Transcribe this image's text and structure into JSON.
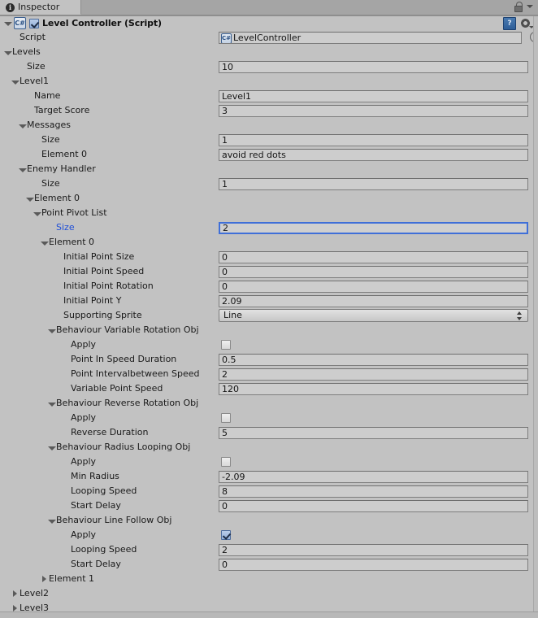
{
  "window": {
    "tab_label": "Inspector",
    "tab_icon": "info-circle-icon",
    "lock_icon": "padlock-open-icon",
    "menu_icon": "chevron-down-icon"
  },
  "component": {
    "title": "Level Controller (Script)",
    "script_icon": "csharp-script-icon",
    "enabled": true,
    "help_icon": "help-book-icon",
    "gear_icon": "gear-icon"
  },
  "colors": {
    "background": "#c2c2c2",
    "field_background": "#cdcdcd",
    "focus_border": "#3f6fd8",
    "selected_label": "#1f4fd8",
    "checkbox_checked": "#93b0da"
  },
  "rows": [
    {
      "label": "Script",
      "indent": 1,
      "fold": "none",
      "type": "object",
      "value": "LevelController",
      "picker": true
    },
    {
      "label": "Levels",
      "indent": 0,
      "fold": "open",
      "type": "none"
    },
    {
      "label": "Size",
      "indent": 2,
      "fold": "none",
      "type": "text",
      "value": "10"
    },
    {
      "label": "Level1",
      "indent": 1,
      "fold": "open",
      "type": "none"
    },
    {
      "label": "Name",
      "indent": 3,
      "fold": "none",
      "type": "text",
      "value": "Level1"
    },
    {
      "label": "Target Score",
      "indent": 3,
      "fold": "none",
      "type": "text",
      "value": "3"
    },
    {
      "label": "Messages",
      "indent": 2,
      "fold": "open",
      "type": "none"
    },
    {
      "label": "Size",
      "indent": 4,
      "fold": "none",
      "type": "text",
      "value": "1"
    },
    {
      "label": "Element 0",
      "indent": 4,
      "fold": "none",
      "type": "text",
      "value": "avoid red dots"
    },
    {
      "label": "Enemy Handler",
      "indent": 2,
      "fold": "open",
      "type": "none"
    },
    {
      "label": "Size",
      "indent": 4,
      "fold": "none",
      "type": "text",
      "value": "1"
    },
    {
      "label": "Element 0",
      "indent": 3,
      "fold": "open",
      "type": "none"
    },
    {
      "label": "Point Pivot List",
      "indent": 4,
      "fold": "open",
      "type": "none"
    },
    {
      "label": "Size",
      "indent": 6,
      "fold": "none",
      "type": "text",
      "value": "2",
      "focused": true,
      "selected": true
    },
    {
      "label": "Element 0",
      "indent": 5,
      "fold": "open",
      "type": "none"
    },
    {
      "label": "Initial Point Size",
      "indent": 7,
      "fold": "none",
      "type": "text",
      "value": "0"
    },
    {
      "label": "Initial Point Speed",
      "indent": 7,
      "fold": "none",
      "type": "text",
      "value": "0"
    },
    {
      "label": "Initial Point Rotation",
      "indent": 7,
      "fold": "none",
      "type": "text",
      "value": "0"
    },
    {
      "label": "Initial Point Y",
      "indent": 7,
      "fold": "none",
      "type": "text",
      "value": "2.09"
    },
    {
      "label": "Supporting Sprite",
      "indent": 7,
      "fold": "none",
      "type": "dropdown",
      "value": "Line"
    },
    {
      "label": "Behaviour Variable Rotation Obj",
      "indent": 6,
      "fold": "open",
      "type": "none"
    },
    {
      "label": "Apply",
      "indent": 8,
      "fold": "none",
      "type": "checkbox",
      "checked": false
    },
    {
      "label": "Point In Speed Duration",
      "indent": 8,
      "fold": "none",
      "type": "text",
      "value": "0.5"
    },
    {
      "label": "Point Intervalbetween Speed",
      "indent": 8,
      "fold": "none",
      "type": "text",
      "value": "2"
    },
    {
      "label": "Variable Point Speed",
      "indent": 8,
      "fold": "none",
      "type": "text",
      "value": "120"
    },
    {
      "label": "Behaviour Reverse Rotation Obj",
      "indent": 6,
      "fold": "open",
      "type": "none"
    },
    {
      "label": "Apply",
      "indent": 8,
      "fold": "none",
      "type": "checkbox",
      "checked": false
    },
    {
      "label": "Reverse Duration",
      "indent": 8,
      "fold": "none",
      "type": "text",
      "value": "5"
    },
    {
      "label": "Behaviour Radius Looping Obj",
      "indent": 6,
      "fold": "open",
      "type": "none"
    },
    {
      "label": "Apply",
      "indent": 8,
      "fold": "none",
      "type": "checkbox",
      "checked": false
    },
    {
      "label": "Min Radius",
      "indent": 8,
      "fold": "none",
      "type": "text",
      "value": "-2.09"
    },
    {
      "label": "Looping Speed",
      "indent": 8,
      "fold": "none",
      "type": "text",
      "value": "8"
    },
    {
      "label": "Start Delay",
      "indent": 8,
      "fold": "none",
      "type": "text",
      "value": "0"
    },
    {
      "label": "Behaviour Line Follow Obj",
      "indent": 6,
      "fold": "open",
      "type": "none"
    },
    {
      "label": "Apply",
      "indent": 8,
      "fold": "none",
      "type": "checkbox",
      "checked": true
    },
    {
      "label": "Looping Speed",
      "indent": 8,
      "fold": "none",
      "type": "text",
      "value": "2"
    },
    {
      "label": "Start Delay",
      "indent": 8,
      "fold": "none",
      "type": "text",
      "value": "0"
    },
    {
      "label": "Element 1",
      "indent": 5,
      "fold": "closed",
      "type": "none"
    },
    {
      "label": "Level2",
      "indent": 1,
      "fold": "closed",
      "type": "none"
    },
    {
      "label": "Level3",
      "indent": 1,
      "fold": "closed",
      "type": "none"
    }
  ]
}
